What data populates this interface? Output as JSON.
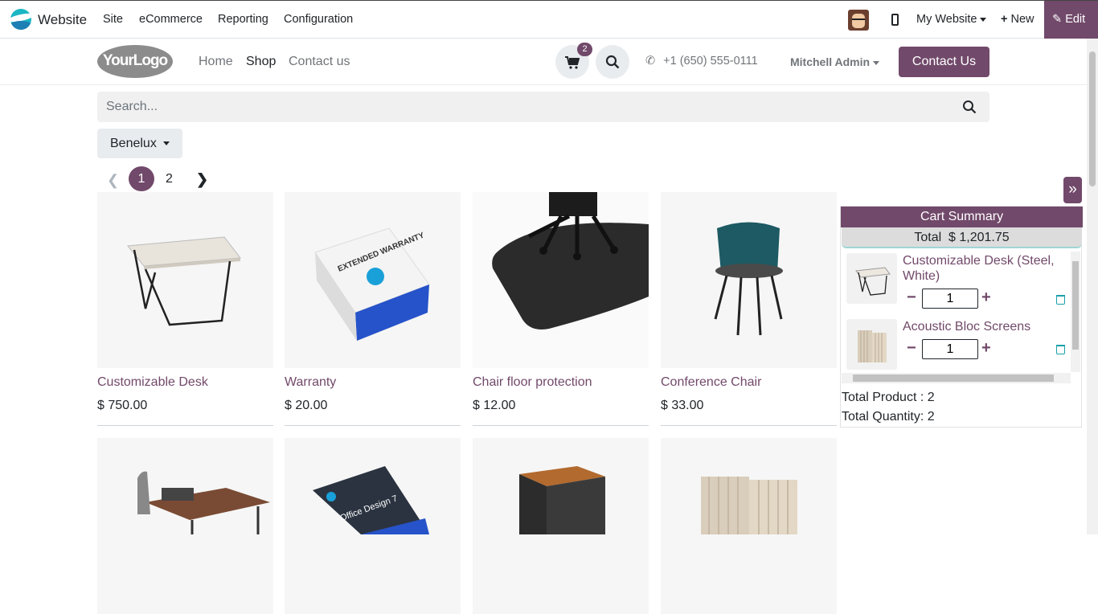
{
  "topbar": {
    "app_name": "Website",
    "menu": [
      "Site",
      "eCommerce",
      "Reporting",
      "Configuration"
    ],
    "website_selector": "My Website",
    "new_label": "New",
    "edit_label": "Edit"
  },
  "header": {
    "logo_text": "YourLogo",
    "nav": [
      "Home",
      "Shop",
      "Contact us"
    ],
    "cart_count": "2",
    "phone": "+1 (650) 555-0111",
    "user": "Mitchell Admin",
    "contact_button": "Contact Us"
  },
  "shop": {
    "search_placeholder": "Search...",
    "pricelist": "Benelux",
    "pager": {
      "current": "1",
      "other": "2"
    },
    "products": [
      {
        "name": "Customizable Desk",
        "price": "$ 750.00"
      },
      {
        "name": "Warranty",
        "price": "$ 20.00"
      },
      {
        "name": "Chair floor protection",
        "price": "$ 12.00"
      },
      {
        "name": "Conference Chair",
        "price": "$ 33.00"
      }
    ],
    "warranty_box_text": "EXTENDED WARRANTY",
    "office_design_text": "Office Design 7"
  },
  "cart_summary": {
    "title": "Cart Summary",
    "total_label": "Total",
    "total_value": "$ 1,201.75",
    "items": [
      {
        "name": "Customizable Desk (Steel, White)",
        "qty": "1"
      },
      {
        "name": "Acoustic Bloc Screens",
        "qty": "1"
      }
    ],
    "total_product": "Total Product : 2",
    "total_quantity": "Total Quantity: 2"
  },
  "colors": {
    "brand": "#71496a",
    "accent": "#1aa0a8"
  }
}
